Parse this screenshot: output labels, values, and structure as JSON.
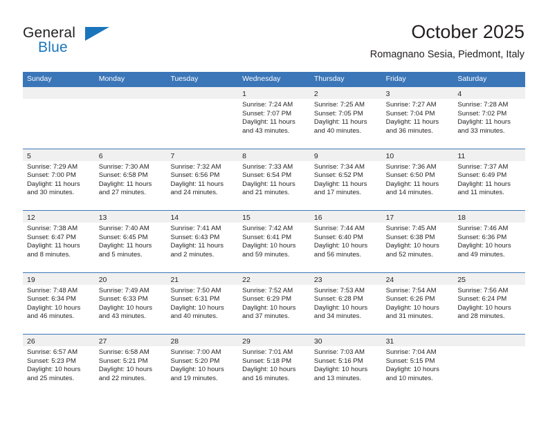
{
  "logo": {
    "word1": "General",
    "word2": "Blue",
    "accent_color": "#1b75bb"
  },
  "header": {
    "title": "October 2025",
    "subtitle": "Romagnano Sesia, Piedmont, Italy"
  },
  "theme": {
    "header_blue": "#3a76b8",
    "date_band_gray": "#f0f0f0",
    "text_color": "#231f20"
  },
  "weekdays": [
    "Sunday",
    "Monday",
    "Tuesday",
    "Wednesday",
    "Thursday",
    "Friday",
    "Saturday"
  ],
  "weeks": [
    [
      {
        "day": "",
        "sunrise": "",
        "sunset": "",
        "daylight1": "",
        "daylight2": ""
      },
      {
        "day": "",
        "sunrise": "",
        "sunset": "",
        "daylight1": "",
        "daylight2": ""
      },
      {
        "day": "",
        "sunrise": "",
        "sunset": "",
        "daylight1": "",
        "daylight2": ""
      },
      {
        "day": "1",
        "sunrise": "Sunrise: 7:24 AM",
        "sunset": "Sunset: 7:07 PM",
        "daylight1": "Daylight: 11 hours",
        "daylight2": "and 43 minutes."
      },
      {
        "day": "2",
        "sunrise": "Sunrise: 7:25 AM",
        "sunset": "Sunset: 7:05 PM",
        "daylight1": "Daylight: 11 hours",
        "daylight2": "and 40 minutes."
      },
      {
        "day": "3",
        "sunrise": "Sunrise: 7:27 AM",
        "sunset": "Sunset: 7:04 PM",
        "daylight1": "Daylight: 11 hours",
        "daylight2": "and 36 minutes."
      },
      {
        "day": "4",
        "sunrise": "Sunrise: 7:28 AM",
        "sunset": "Sunset: 7:02 PM",
        "daylight1": "Daylight: 11 hours",
        "daylight2": "and 33 minutes."
      }
    ],
    [
      {
        "day": "5",
        "sunrise": "Sunrise: 7:29 AM",
        "sunset": "Sunset: 7:00 PM",
        "daylight1": "Daylight: 11 hours",
        "daylight2": "and 30 minutes."
      },
      {
        "day": "6",
        "sunrise": "Sunrise: 7:30 AM",
        "sunset": "Sunset: 6:58 PM",
        "daylight1": "Daylight: 11 hours",
        "daylight2": "and 27 minutes."
      },
      {
        "day": "7",
        "sunrise": "Sunrise: 7:32 AM",
        "sunset": "Sunset: 6:56 PM",
        "daylight1": "Daylight: 11 hours",
        "daylight2": "and 24 minutes."
      },
      {
        "day": "8",
        "sunrise": "Sunrise: 7:33 AM",
        "sunset": "Sunset: 6:54 PM",
        "daylight1": "Daylight: 11 hours",
        "daylight2": "and 21 minutes."
      },
      {
        "day": "9",
        "sunrise": "Sunrise: 7:34 AM",
        "sunset": "Sunset: 6:52 PM",
        "daylight1": "Daylight: 11 hours",
        "daylight2": "and 17 minutes."
      },
      {
        "day": "10",
        "sunrise": "Sunrise: 7:36 AM",
        "sunset": "Sunset: 6:50 PM",
        "daylight1": "Daylight: 11 hours",
        "daylight2": "and 14 minutes."
      },
      {
        "day": "11",
        "sunrise": "Sunrise: 7:37 AM",
        "sunset": "Sunset: 6:49 PM",
        "daylight1": "Daylight: 11 hours",
        "daylight2": "and 11 minutes."
      }
    ],
    [
      {
        "day": "12",
        "sunrise": "Sunrise: 7:38 AM",
        "sunset": "Sunset: 6:47 PM",
        "daylight1": "Daylight: 11 hours",
        "daylight2": "and 8 minutes."
      },
      {
        "day": "13",
        "sunrise": "Sunrise: 7:40 AM",
        "sunset": "Sunset: 6:45 PM",
        "daylight1": "Daylight: 11 hours",
        "daylight2": "and 5 minutes."
      },
      {
        "day": "14",
        "sunrise": "Sunrise: 7:41 AM",
        "sunset": "Sunset: 6:43 PM",
        "daylight1": "Daylight: 11 hours",
        "daylight2": "and 2 minutes."
      },
      {
        "day": "15",
        "sunrise": "Sunrise: 7:42 AM",
        "sunset": "Sunset: 6:41 PM",
        "daylight1": "Daylight: 10 hours",
        "daylight2": "and 59 minutes."
      },
      {
        "day": "16",
        "sunrise": "Sunrise: 7:44 AM",
        "sunset": "Sunset: 6:40 PM",
        "daylight1": "Daylight: 10 hours",
        "daylight2": "and 56 minutes."
      },
      {
        "day": "17",
        "sunrise": "Sunrise: 7:45 AM",
        "sunset": "Sunset: 6:38 PM",
        "daylight1": "Daylight: 10 hours",
        "daylight2": "and 52 minutes."
      },
      {
        "day": "18",
        "sunrise": "Sunrise: 7:46 AM",
        "sunset": "Sunset: 6:36 PM",
        "daylight1": "Daylight: 10 hours",
        "daylight2": "and 49 minutes."
      }
    ],
    [
      {
        "day": "19",
        "sunrise": "Sunrise: 7:48 AM",
        "sunset": "Sunset: 6:34 PM",
        "daylight1": "Daylight: 10 hours",
        "daylight2": "and 46 minutes."
      },
      {
        "day": "20",
        "sunrise": "Sunrise: 7:49 AM",
        "sunset": "Sunset: 6:33 PM",
        "daylight1": "Daylight: 10 hours",
        "daylight2": "and 43 minutes."
      },
      {
        "day": "21",
        "sunrise": "Sunrise: 7:50 AM",
        "sunset": "Sunset: 6:31 PM",
        "daylight1": "Daylight: 10 hours",
        "daylight2": "and 40 minutes."
      },
      {
        "day": "22",
        "sunrise": "Sunrise: 7:52 AM",
        "sunset": "Sunset: 6:29 PM",
        "daylight1": "Daylight: 10 hours",
        "daylight2": "and 37 minutes."
      },
      {
        "day": "23",
        "sunrise": "Sunrise: 7:53 AM",
        "sunset": "Sunset: 6:28 PM",
        "daylight1": "Daylight: 10 hours",
        "daylight2": "and 34 minutes."
      },
      {
        "day": "24",
        "sunrise": "Sunrise: 7:54 AM",
        "sunset": "Sunset: 6:26 PM",
        "daylight1": "Daylight: 10 hours",
        "daylight2": "and 31 minutes."
      },
      {
        "day": "25",
        "sunrise": "Sunrise: 7:56 AM",
        "sunset": "Sunset: 6:24 PM",
        "daylight1": "Daylight: 10 hours",
        "daylight2": "and 28 minutes."
      }
    ],
    [
      {
        "day": "26",
        "sunrise": "Sunrise: 6:57 AM",
        "sunset": "Sunset: 5:23 PM",
        "daylight1": "Daylight: 10 hours",
        "daylight2": "and 25 minutes."
      },
      {
        "day": "27",
        "sunrise": "Sunrise: 6:58 AM",
        "sunset": "Sunset: 5:21 PM",
        "daylight1": "Daylight: 10 hours",
        "daylight2": "and 22 minutes."
      },
      {
        "day": "28",
        "sunrise": "Sunrise: 7:00 AM",
        "sunset": "Sunset: 5:20 PM",
        "daylight1": "Daylight: 10 hours",
        "daylight2": "and 19 minutes."
      },
      {
        "day": "29",
        "sunrise": "Sunrise: 7:01 AM",
        "sunset": "Sunset: 5:18 PM",
        "daylight1": "Daylight: 10 hours",
        "daylight2": "and 16 minutes."
      },
      {
        "day": "30",
        "sunrise": "Sunrise: 7:03 AM",
        "sunset": "Sunset: 5:16 PM",
        "daylight1": "Daylight: 10 hours",
        "daylight2": "and 13 minutes."
      },
      {
        "day": "31",
        "sunrise": "Sunrise: 7:04 AM",
        "sunset": "Sunset: 5:15 PM",
        "daylight1": "Daylight: 10 hours",
        "daylight2": "and 10 minutes."
      },
      {
        "day": "",
        "sunrise": "",
        "sunset": "",
        "daylight1": "",
        "daylight2": ""
      }
    ]
  ]
}
